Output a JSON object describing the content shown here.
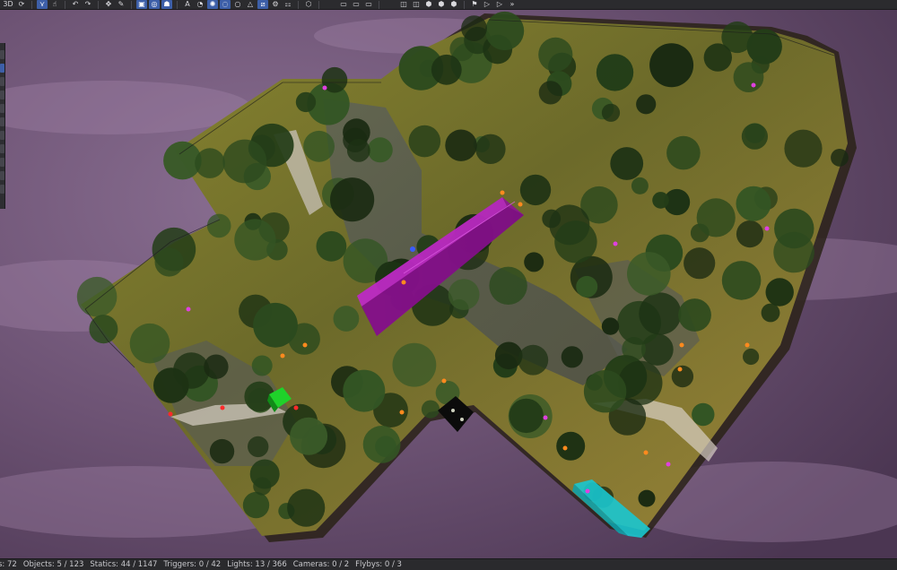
{
  "toolbar": {
    "view_mode_label": "3D",
    "buttons": [
      {
        "name": "view-3d-button",
        "glyph": "3D",
        "active": false
      },
      {
        "name": "rotate-view-button",
        "glyph": "⟳",
        "active": false
      },
      {
        "name": "select-tool-button",
        "glyph": "⋎",
        "active": true
      },
      {
        "name": "pick-tool-button",
        "glyph": "☝",
        "active": false
      },
      {
        "name": "undo-button",
        "glyph": "↶",
        "active": false
      },
      {
        "name": "redo-button",
        "glyph": "↷",
        "active": false
      },
      {
        "name": "move-tool-button",
        "glyph": "✥",
        "active": false
      },
      {
        "name": "paint-tool-button",
        "glyph": "✎",
        "active": false
      },
      {
        "name": "object-filter-button",
        "glyph": "▣",
        "active": true
      },
      {
        "name": "target-filter-button",
        "glyph": "◎",
        "active": true
      },
      {
        "name": "person-filter-button",
        "glyph": "☗",
        "active": true
      },
      {
        "name": "text-filter-button",
        "glyph": "A",
        "active": false
      },
      {
        "name": "sound-filter-button",
        "glyph": "◔",
        "active": false
      },
      {
        "name": "light-filter-button",
        "glyph": "✺",
        "active": true
      },
      {
        "name": "region-filter-button",
        "glyph": "◌",
        "active": true
      },
      {
        "name": "point-filter-button",
        "glyph": "○",
        "active": false
      },
      {
        "name": "warning-filter-button",
        "glyph": "△",
        "active": false
      },
      {
        "name": "trigger-filter-button",
        "glyph": "⧄",
        "active": true
      },
      {
        "name": "snap-filter-button",
        "glyph": "⚙",
        "active": false
      },
      {
        "name": "group-filter-button",
        "glyph": "⚏",
        "active": false
      },
      {
        "name": "mesh-filter-button",
        "glyph": "⬡",
        "active": false
      },
      {
        "name": "layer-toggle-button",
        "glyph": "▭",
        "active": false
      },
      {
        "name": "grid-toggle-button",
        "glyph": "▭",
        "active": false
      },
      {
        "name": "render-toggle-button",
        "glyph": "▭",
        "active": false
      },
      {
        "name": "camera-save-button",
        "glyph": "◫",
        "active": false
      },
      {
        "name": "camera-load-button",
        "glyph": "◫",
        "active": false
      },
      {
        "name": "cube-view-button",
        "glyph": "⬢",
        "active": false
      },
      {
        "name": "cube-top-button",
        "glyph": "⬢",
        "active": false
      },
      {
        "name": "cube-side-button",
        "glyph": "⬢",
        "active": false
      },
      {
        "name": "flag-button",
        "glyph": "⚑",
        "active": false
      },
      {
        "name": "play-button",
        "glyph": "▷",
        "active": false
      },
      {
        "name": "step-button",
        "glyph": "▷",
        "active": false
      },
      {
        "name": "forward-button",
        "glyph": "»",
        "active": false
      }
    ]
  },
  "status": {
    "items": [
      "s: 72",
      "Objects: 5 / 123",
      "Statics: 44 / 1147",
      "Triggers: 0 / 42",
      "Lights: 13 / 366",
      "Cameras: 0 / 2",
      "Flybys: 0 / 3"
    ]
  },
  "colors": {
    "sky": "#6e5676",
    "grass": "#7a7a2a",
    "trigger_volume": "#a020a8",
    "water_volume": "#20d0d0",
    "toolbar_bg": "#2b2b2e",
    "active_button": "#3d5fa8"
  }
}
